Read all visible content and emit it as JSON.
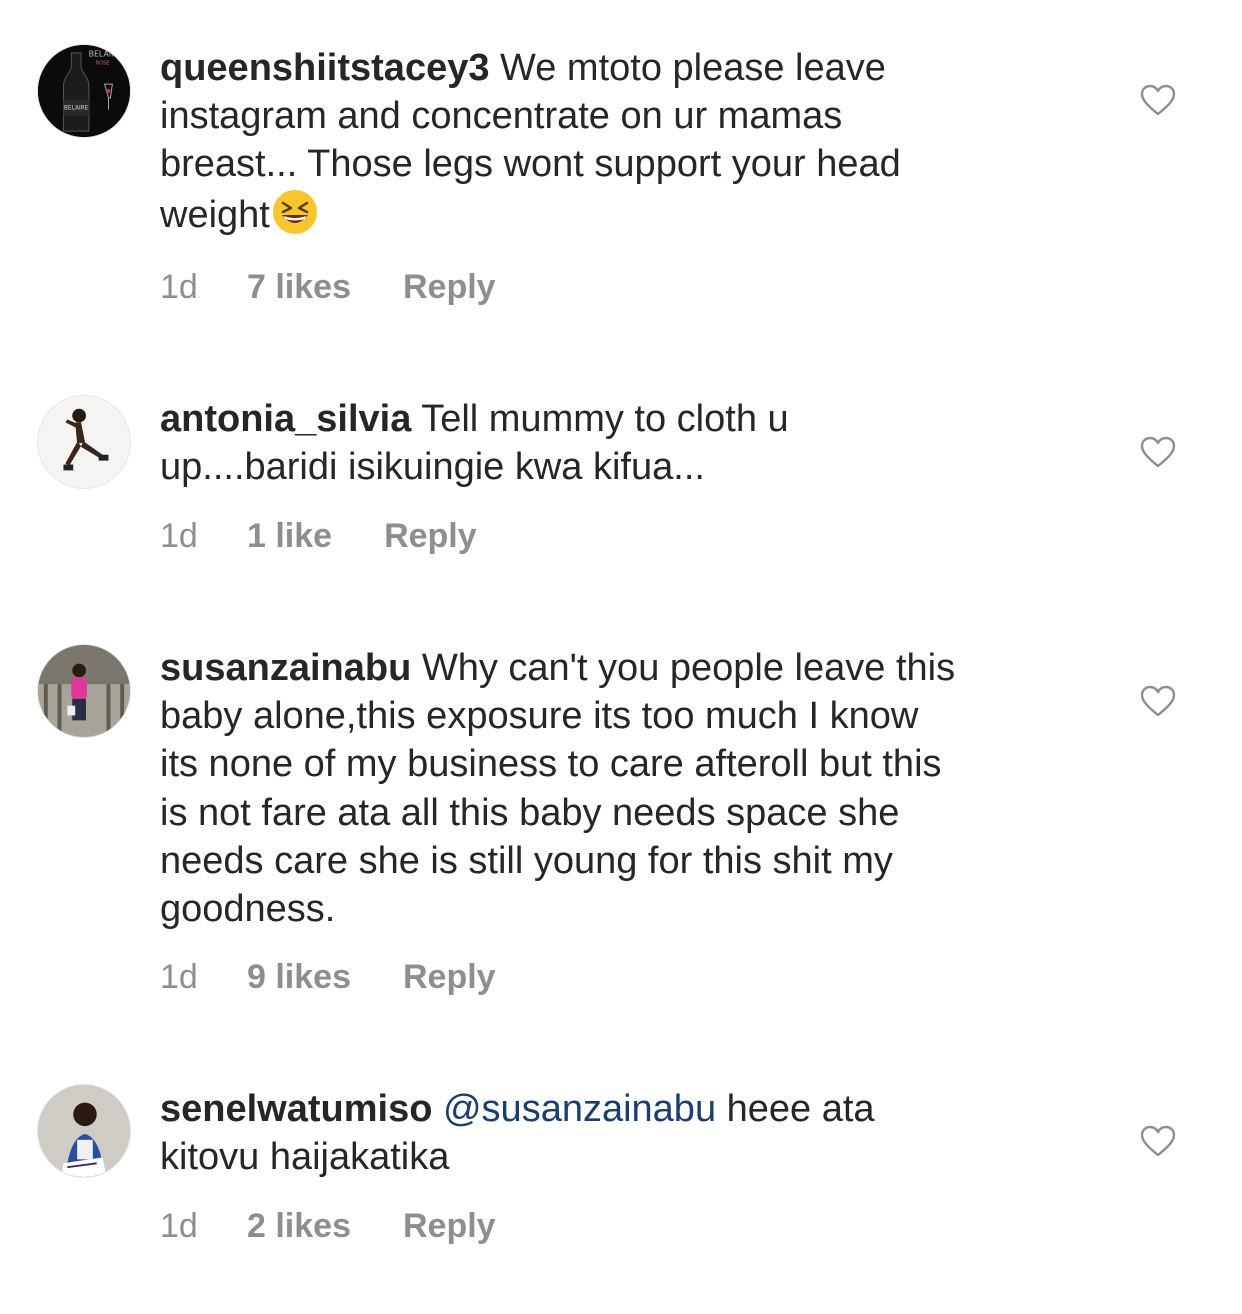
{
  "comments": [
    {
      "username": "queenshiitstacey3",
      "text": "We mtoto please leave\ninstagram and concentrate on ur mamas\nbreast... Those legs wont support your head\nweight",
      "emoji": "grinning-squinting-face",
      "mention": "",
      "time": "1d",
      "likes": "7 likes",
      "reply": "Reply",
      "avatar_icon": "champagne-bottle-avatar",
      "avatar_text": "BELAIRE ROSE"
    },
    {
      "username": "antonia_silvia",
      "text": "Tell mummy to cloth u\nup....baridi isikuingie kwa kifua...",
      "mention": "",
      "time": "1d",
      "likes": "1 like",
      "reply": "Reply",
      "avatar_icon": "person-avatar"
    },
    {
      "username": "susanzainabu",
      "text": "Why can't you people leave this\nbaby alone,this exposure its too much I know\nits none of my business to care afteroll but this\nis not fare ata all this baby needs space she\nneeds care she is still young for this shit my\ngoodness.",
      "mention": "",
      "time": "1d",
      "likes": "9 likes",
      "reply": "Reply",
      "avatar_icon": "person-avatar"
    },
    {
      "username": "senelwatumiso",
      "mention": "@susanzainabu",
      "text": "heee ata\nkitovu haijakatika",
      "time": "1d",
      "likes": "2 likes",
      "reply": "Reply",
      "avatar_icon": "person-avatar"
    }
  ],
  "colors": {
    "text": "#262626",
    "meta": "#8e8e8e",
    "mention": "#1a3e6e",
    "heart_outline": "#8e8e8e"
  }
}
